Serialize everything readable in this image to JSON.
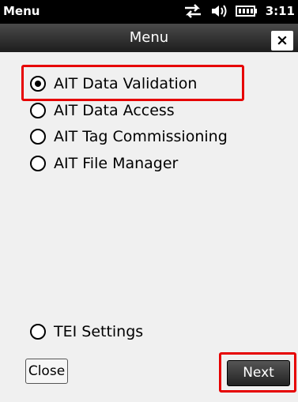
{
  "status_bar": {
    "title": "Menu",
    "time": "3:11",
    "icons": [
      "sync-icon",
      "volume-icon",
      "battery-icon"
    ]
  },
  "title_bar": {
    "title": "Menu",
    "close_label": "×"
  },
  "options": [
    {
      "label": "AIT Data Validation",
      "selected": true
    },
    {
      "label": "AIT Data Access",
      "selected": false
    },
    {
      "label": "AIT Tag Commissioning",
      "selected": false
    },
    {
      "label": "AIT File Manager",
      "selected": false
    },
    {
      "label": "TEI Settings",
      "selected": false
    }
  ],
  "buttons": {
    "close_label": "Close",
    "next_label": "Next"
  },
  "colors": {
    "highlight": "#e60000",
    "background": "#f0f0f0"
  }
}
